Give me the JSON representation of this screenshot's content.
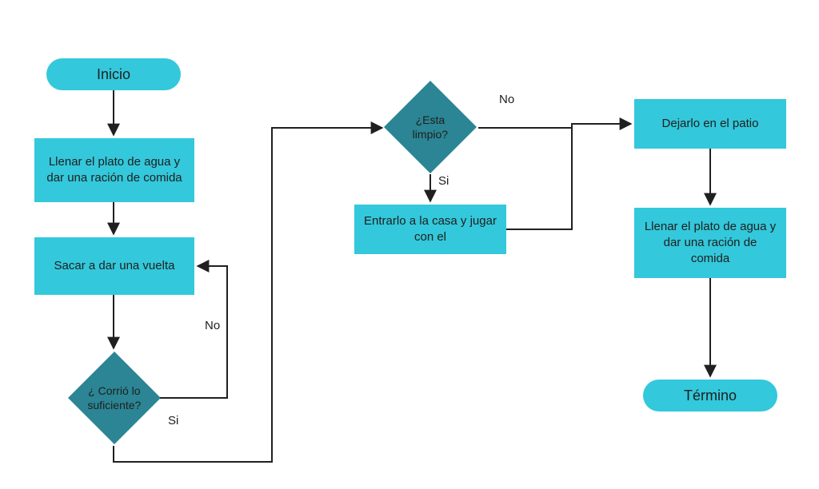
{
  "colors": {
    "terminator_fill": "#33c8db",
    "process_fill": "#33c8db",
    "decision_fill": "#2b8594",
    "stroke": "#202020"
  },
  "nodes": {
    "start": {
      "type": "terminator",
      "label": "Inicio"
    },
    "p1": {
      "type": "process",
      "label": "Llenar el plato de agua y dar una ración de comida"
    },
    "p2": {
      "type": "process",
      "label": "Sacar a dar una vuelta"
    },
    "d1": {
      "type": "decision",
      "label": "¿ Corrió lo suficiente?"
    },
    "d2": {
      "type": "decision",
      "label": "¿Esta limpio?"
    },
    "p3": {
      "type": "process",
      "label": "Entrarlo a la casa y jugar con el"
    },
    "p4": {
      "type": "process",
      "label": "Dejarlo en el patio"
    },
    "p5": {
      "type": "process",
      "label": "Llenar el plato de agua y dar una ración de comida"
    },
    "end": {
      "type": "terminator",
      "label": "Término"
    }
  },
  "edges": [
    {
      "from": "start",
      "to": "p1",
      "label": ""
    },
    {
      "from": "p1",
      "to": "p2",
      "label": ""
    },
    {
      "from": "p2",
      "to": "d1",
      "label": ""
    },
    {
      "from": "d1",
      "to": "p2",
      "label": "No"
    },
    {
      "from": "d1",
      "to": "d2",
      "label": "Si"
    },
    {
      "from": "d2",
      "to": "p3",
      "label": "Si"
    },
    {
      "from": "d2",
      "to": "p4",
      "label": "No"
    },
    {
      "from": "p3",
      "to": "p4_path",
      "label": ""
    },
    {
      "from": "p4",
      "to": "p5",
      "label": ""
    },
    {
      "from": "p5",
      "to": "end",
      "label": ""
    }
  ],
  "edge_labels": {
    "d1_no": "No",
    "d1_si": "Si",
    "d2_no": "No",
    "d2_si": "Si"
  }
}
